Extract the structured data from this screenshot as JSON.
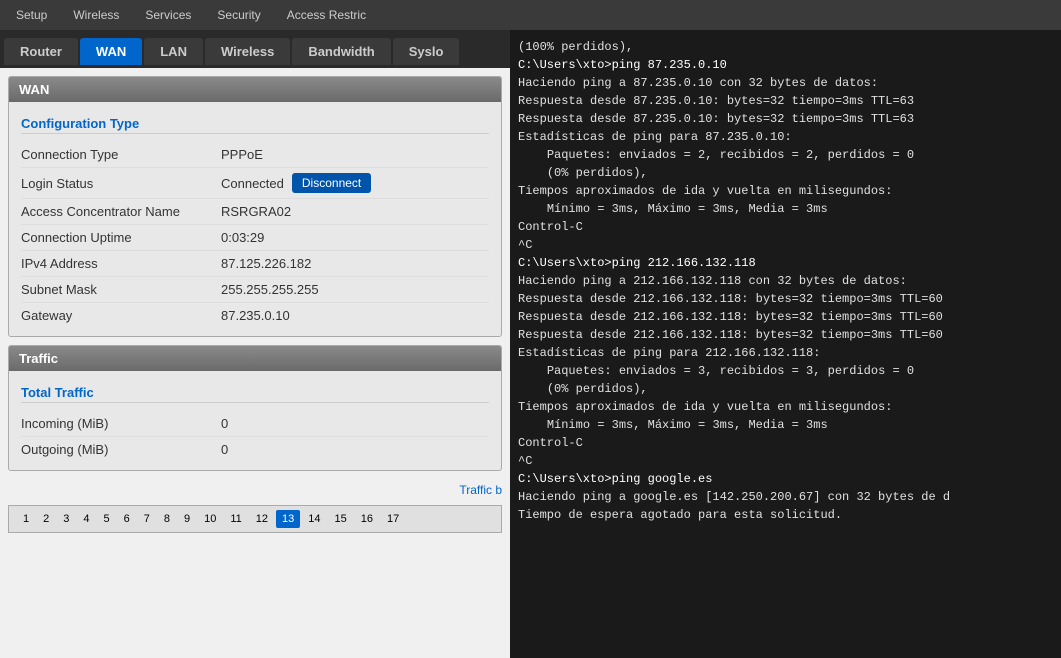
{
  "topNav": {
    "items": [
      "Setup",
      "Wireless",
      "Services",
      "Security",
      "Access Restric"
    ]
  },
  "tabs": [
    {
      "label": "Router",
      "active": false
    },
    {
      "label": "WAN",
      "active": true
    },
    {
      "label": "LAN",
      "active": false
    },
    {
      "label": "Wireless",
      "active": false
    },
    {
      "label": "Bandwidth",
      "active": false
    },
    {
      "label": "Syslo",
      "active": false
    }
  ],
  "wan": {
    "title": "WAN",
    "configSection": "Configuration Type",
    "fields": [
      {
        "label": "Connection Type",
        "value": "PPPoE"
      },
      {
        "label": "Login Status",
        "value": "Connected",
        "hasButton": true,
        "buttonLabel": "Disconnect"
      },
      {
        "label": "Access Concentrator Name",
        "value": "RSRGRA02"
      },
      {
        "label": "Connection Uptime",
        "value": "0:03:29"
      },
      {
        "label": "IPv4 Address",
        "value": "87.125.226.182"
      },
      {
        "label": "Subnet Mask",
        "value": "255.255.255.255"
      },
      {
        "label": "Gateway",
        "value": "87.235.0.10"
      }
    ]
  },
  "traffic": {
    "title": "Traffic",
    "totalTraffic": "Total Traffic",
    "fields": [
      {
        "label": "Incoming (MiB)",
        "value": "0"
      },
      {
        "label": "Outgoing (MiB)",
        "value": "0"
      }
    ],
    "trafficLink": "Traffic b",
    "pagination": {
      "pages": [
        1,
        2,
        3,
        4,
        5,
        6,
        7,
        8,
        9,
        10,
        11,
        12,
        13,
        14,
        15,
        16,
        17
      ],
      "activePage": 13
    }
  },
  "terminal": {
    "lines": [
      {
        "text": "(100% perdidos),",
        "type": "normal"
      },
      {
        "text": "",
        "type": "normal"
      },
      {
        "text": "C:\\Users\\xto>ping 87.235.0.10",
        "type": "cmd"
      },
      {
        "text": "",
        "type": "normal"
      },
      {
        "text": "Haciendo ping a 87.235.0.10 con 32 bytes de datos:",
        "type": "normal"
      },
      {
        "text": "Respuesta desde 87.235.0.10: bytes=32 tiempo=3ms TTL=63",
        "type": "normal"
      },
      {
        "text": "Respuesta desde 87.235.0.10: bytes=32 tiempo=3ms TTL=63",
        "type": "normal"
      },
      {
        "text": "",
        "type": "normal"
      },
      {
        "text": "Estadísticas de ping para 87.235.0.10:",
        "type": "normal"
      },
      {
        "text": "    Paquetes: enviados = 2, recibidos = 2, perdidos = 0",
        "type": "normal"
      },
      {
        "text": "    (0% perdidos),",
        "type": "normal"
      },
      {
        "text": "Tiempos aproximados de ida y vuelta en milisegundos:",
        "type": "normal"
      },
      {
        "text": "    Mínimo = 3ms, Máximo = 3ms, Media = 3ms",
        "type": "normal"
      },
      {
        "text": "Control-C",
        "type": "normal"
      },
      {
        "text": "^C",
        "type": "normal"
      },
      {
        "text": "C:\\Users\\xto>ping 212.166.132.118",
        "type": "cmd"
      },
      {
        "text": "",
        "type": "normal"
      },
      {
        "text": "Haciendo ping a 212.166.132.118 con 32 bytes de datos:",
        "type": "normal"
      },
      {
        "text": "Respuesta desde 212.166.132.118: bytes=32 tiempo=3ms TTL=60",
        "type": "normal"
      },
      {
        "text": "Respuesta desde 212.166.132.118: bytes=32 tiempo=3ms TTL=60",
        "type": "normal"
      },
      {
        "text": "Respuesta desde 212.166.132.118: bytes=32 tiempo=3ms TTL=60",
        "type": "normal"
      },
      {
        "text": "",
        "type": "normal"
      },
      {
        "text": "Estadísticas de ping para 212.166.132.118:",
        "type": "normal"
      },
      {
        "text": "    Paquetes: enviados = 3, recibidos = 3, perdidos = 0",
        "type": "normal"
      },
      {
        "text": "    (0% perdidos),",
        "type": "normal"
      },
      {
        "text": "Tiempos aproximados de ida y vuelta en milisegundos:",
        "type": "normal"
      },
      {
        "text": "    Mínimo = 3ms, Máximo = 3ms, Media = 3ms",
        "type": "normal"
      },
      {
        "text": "Control-C",
        "type": "normal"
      },
      {
        "text": "^C",
        "type": "normal"
      },
      {
        "text": "C:\\Users\\xto>ping google.es",
        "type": "cmd"
      },
      {
        "text": "",
        "type": "normal"
      },
      {
        "text": "Haciendo ping a google.es [142.250.200.67] con 32 bytes de d",
        "type": "normal"
      },
      {
        "text": "Tiempo de espera agotado para esta solicitud.",
        "type": "normal"
      }
    ]
  }
}
